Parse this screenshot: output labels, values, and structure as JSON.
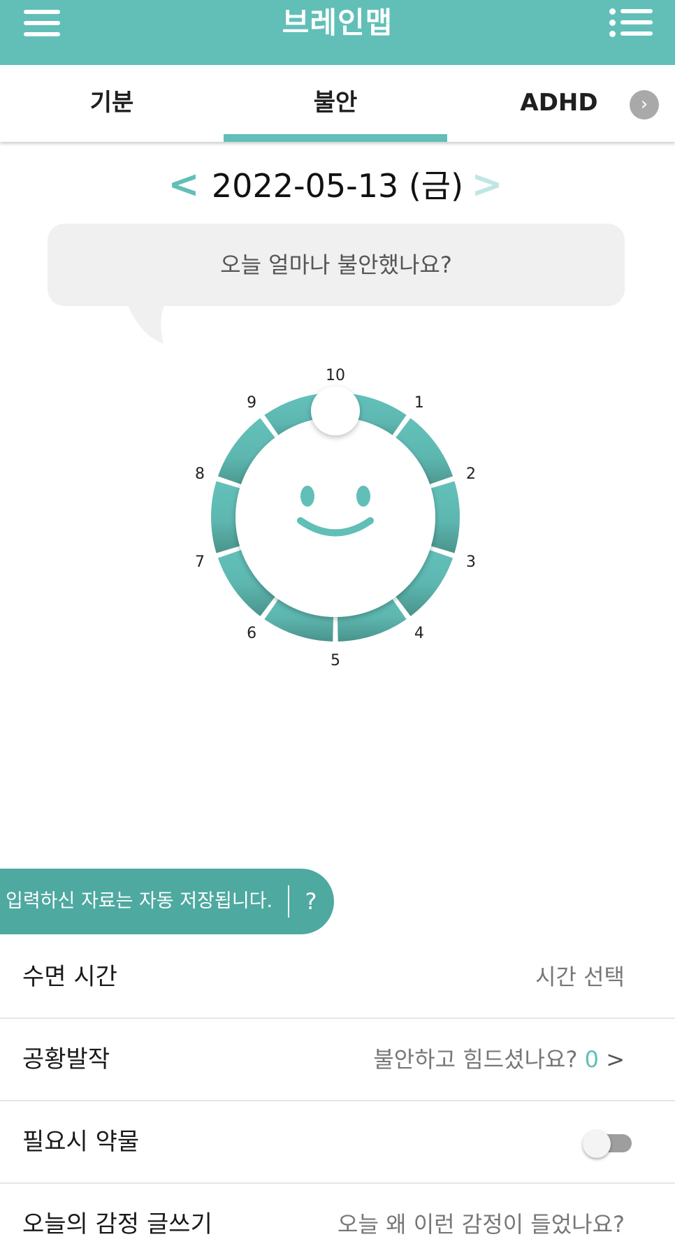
{
  "app": {
    "title": "브레인맵"
  },
  "tabs": [
    {
      "label": "기분",
      "active": false
    },
    {
      "label": "불안",
      "active": true
    },
    {
      "label": "ADHD",
      "active": false
    }
  ],
  "date_nav": {
    "prev": "<",
    "date": "2022-05-13 (금)",
    "next": ">"
  },
  "question": "오늘 얼마나 불안했나요?",
  "dial": {
    "labels": [
      "1",
      "2",
      "3",
      "4",
      "5",
      "6",
      "7",
      "8",
      "9",
      "10"
    ],
    "selected_value": 10,
    "face": "smile",
    "colors": {
      "light": "#63c1ba",
      "dark": "#4a938c",
      "face": "#61bfb8"
    }
  },
  "toast": {
    "text": "입력하신 자료는 자동 저장됩니다.",
    "help": "?"
  },
  "rows": [
    {
      "label": "수면 시간",
      "value": "시간 선택"
    },
    {
      "label": "공황발작",
      "value": "불안하고 힘드셨나요?",
      "count": "0",
      "arrow": ">"
    },
    {
      "label": "필요시 약물",
      "toggle": false
    },
    {
      "label": "오늘의 감정 글쓰기",
      "value": "오늘 왜 이런 감정이 들었나요?"
    }
  ],
  "colors": {
    "accent": "#61bfb8",
    "accent_dark": "#4ea9a0"
  }
}
